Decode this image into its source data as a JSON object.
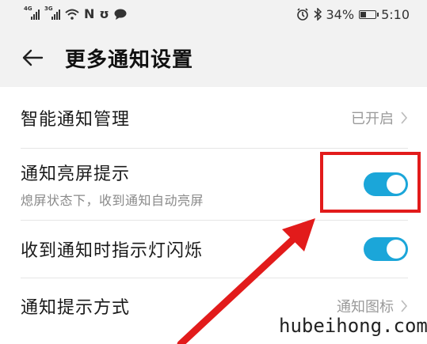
{
  "status_bar": {
    "signal1_gen": "4G",
    "signal2_gen": "3G",
    "battery_percent": "34%",
    "time": "5:10",
    "battery_level": 0.34,
    "left_icons": [
      "wifi-icon",
      "nfc-icon",
      "shield-icon",
      "message-icon"
    ],
    "right_icons": [
      "alarm-icon",
      "bluetooth-icon"
    ]
  },
  "header": {
    "title": "更多通知设置"
  },
  "settings": {
    "smart_notification": {
      "title": "智能通知管理",
      "value": "已开启"
    },
    "screen_on": {
      "title": "通知亮屏提示",
      "subtitle": "熄屏状态下，收到通知自动亮屏",
      "enabled": true
    },
    "indicator_light": {
      "title": "收到通知时指示灯闪烁",
      "enabled": true
    },
    "notification_style": {
      "title": "通知提示方式",
      "value": "通知图标"
    }
  },
  "colors": {
    "toggle_on": "#1ba6d9",
    "highlight": "#e21b1b"
  },
  "watermark": "hubeihong.com"
}
